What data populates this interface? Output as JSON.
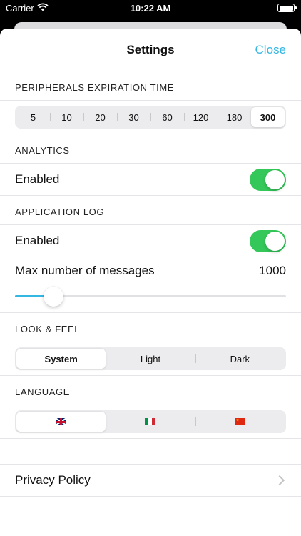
{
  "status": {
    "carrier": "Carrier",
    "time": "10:22 AM"
  },
  "nav": {
    "title": "Settings",
    "close_label": "Close"
  },
  "peripherals": {
    "header": "PERIPHERALS EXPIRATION TIME",
    "options": [
      "5",
      "10",
      "20",
      "30",
      "60",
      "120",
      "180",
      "300"
    ],
    "selected": "300"
  },
  "analytics": {
    "header": "ANALYTICS",
    "enabled_label": "Enabled",
    "enabled": true
  },
  "app_log": {
    "header": "APPLICATION LOG",
    "enabled_label": "Enabled",
    "enabled": true,
    "max_label": "Max number of messages",
    "max_value": "1000",
    "slider_fraction": 0.12
  },
  "look_feel": {
    "header": "LOOK & FEEL",
    "options": [
      "System",
      "Light",
      "Dark"
    ],
    "selected": "System"
  },
  "language": {
    "header": "LANGUAGE",
    "flags": [
      "uk-flag-icon",
      "italy-flag-icon",
      "china-flag-icon"
    ],
    "selected": "uk-flag-icon"
  },
  "privacy": {
    "label": "Privacy Policy"
  },
  "colors": {
    "accent": "#35b7e3",
    "toggle_on": "#34c759"
  }
}
